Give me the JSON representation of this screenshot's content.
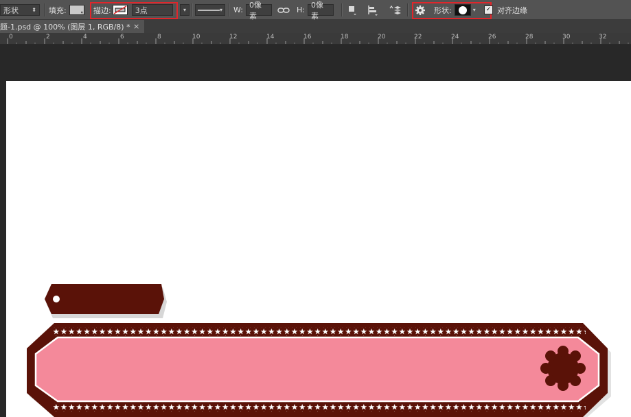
{
  "options_bar": {
    "mode_select": "形状",
    "fill_label": "填充:",
    "stroke_label": "描边:",
    "stroke_width": "3点",
    "w_label": "W:",
    "w_value": "0像素",
    "h_label": "H:",
    "h_value": "0像素",
    "shape_label": "形状:",
    "align_edges_label": "对齐边缘",
    "align_edges_checked": true
  },
  "document_tab": {
    "title": "题-1.psd @ 100% (图层 1, RGB/8) *",
    "close": "×"
  },
  "ruler": {
    "labels": [
      "0",
      "2",
      "4",
      "6",
      "8",
      "10",
      "12",
      "14",
      "16",
      "18",
      "20",
      "22",
      "24",
      "26",
      "28",
      "30",
      "32"
    ]
  },
  "colors": {
    "accent_highlight": "#e0262b",
    "tag_fill": "#5a1208",
    "banner_border": "#5a1208",
    "banner_fill": "#f4899a",
    "canvas": "#ffffff"
  },
  "icons": {
    "link": "link-icon",
    "gear": "gear-icon",
    "path_ops": "path-operations-icon",
    "path_align": "path-alignment-icon",
    "path_arrange": "path-arrangement-icon",
    "stroke_line": "stroke-line-style-icon"
  }
}
